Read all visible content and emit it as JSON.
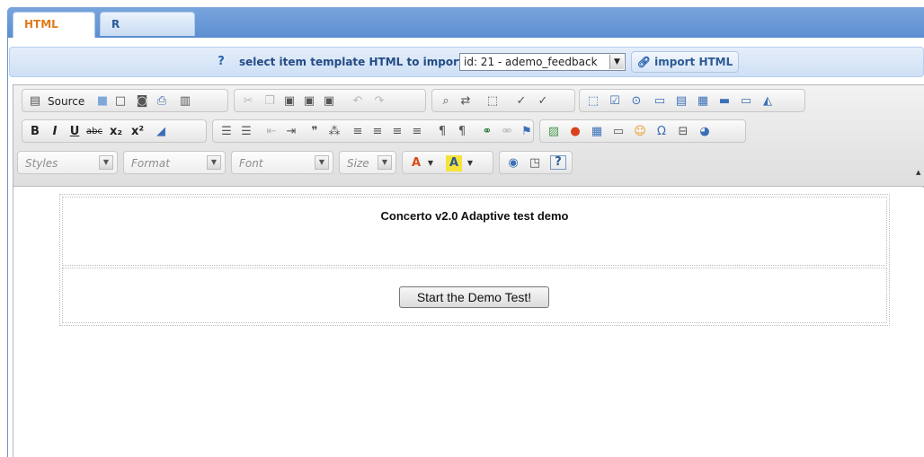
{
  "tabs": [
    {
      "label": "HTML layer",
      "active": true
    },
    {
      "label": "R Interaction",
      "active": false
    }
  ],
  "import_bar": {
    "help_symbol": "?",
    "label": "select item template HTML to import:",
    "selected_template": "id: 21 - ademo_feedback",
    "import_button": "import HTML"
  },
  "editor": {
    "toolbar": {
      "source_label": "Source",
      "combos": {
        "styles": "Styles",
        "format": "Format",
        "font": "Font",
        "size": "Size"
      },
      "help_symbol": "?"
    },
    "content": {
      "title": "Concerto v2.0 Adaptive test demo",
      "start_button": "Start the Demo Test!"
    }
  },
  "colors": {
    "tab_active_text": "#e07a1b",
    "import_text": "#234c86",
    "frame_blue": "#4d7fc1"
  }
}
